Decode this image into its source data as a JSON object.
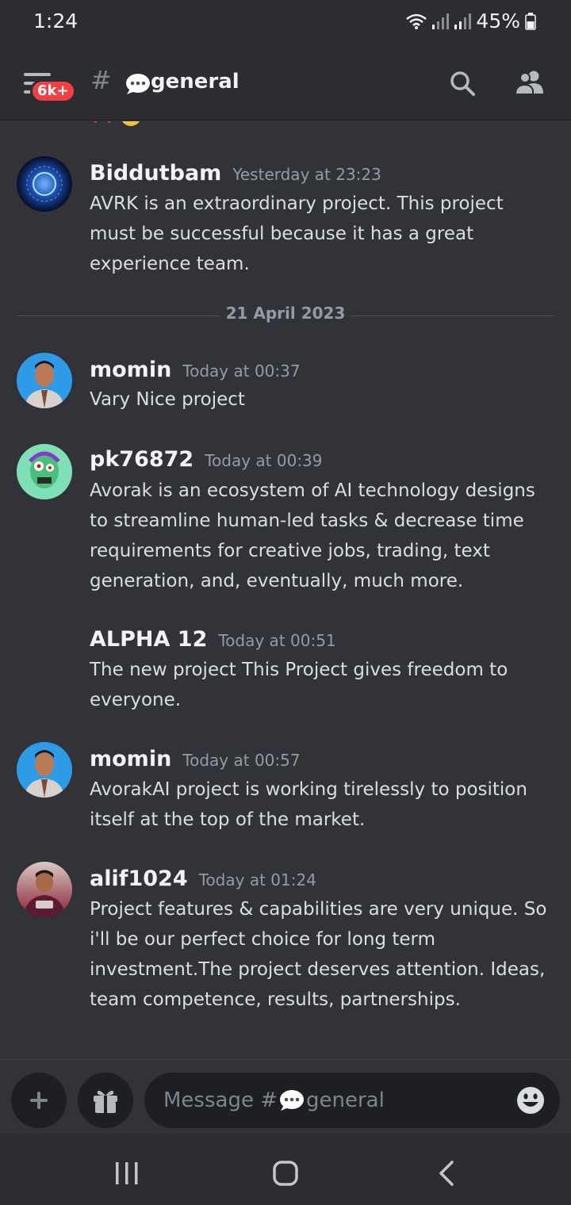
{
  "status": {
    "time": "1:24",
    "battery": "45%"
  },
  "header": {
    "hash": "#",
    "channel": "general",
    "unread_badge": "6k+"
  },
  "chat": {
    "date_divider": "21 April 2023",
    "messages": [
      {
        "author": "Biddutbam",
        "time": "Yesterday at 23:23",
        "text": "AVRK is an extraordinary project. This project must be successful because it has a great experience team."
      },
      {
        "author": "momin",
        "time": "Today at 00:37",
        "text": "Vary Nice project"
      },
      {
        "author": "pk76872",
        "time": "Today at 00:39",
        "text": "Avorak is an ecosystem of AI technology designs to streamline human-led tasks & decrease time requirements for creative jobs, trading, text generation, and, eventually, much more."
      },
      {
        "author": "ALPHA 12",
        "time": "Today at 00:51",
        "text": "The new project This Project gives freedom to everyone."
      },
      {
        "author": "momin",
        "time": "Today at 00:57",
        "text": "AvorakAI project is working tirelessly to position itself at the top of the market."
      },
      {
        "author": "alif1024",
        "time": "Today at 01:24",
        "text": "Project features & capabilities are very unique. So i'll be our perfect choice for long term investment.The project deserves attention. Ideas, team competence, results, partnerships."
      }
    ]
  },
  "composer": {
    "placeholder_prefix": "Message #",
    "placeholder_channel": "general"
  },
  "colors": {
    "background": "#313338",
    "header": "#2b2d31",
    "badge": "#f23f43",
    "input": "#1e1f22"
  },
  "icons": [
    "menu-icon",
    "search-icon",
    "members-icon",
    "plus-icon",
    "gift-icon",
    "emoji-icon",
    "speech-bubble-icon"
  ]
}
